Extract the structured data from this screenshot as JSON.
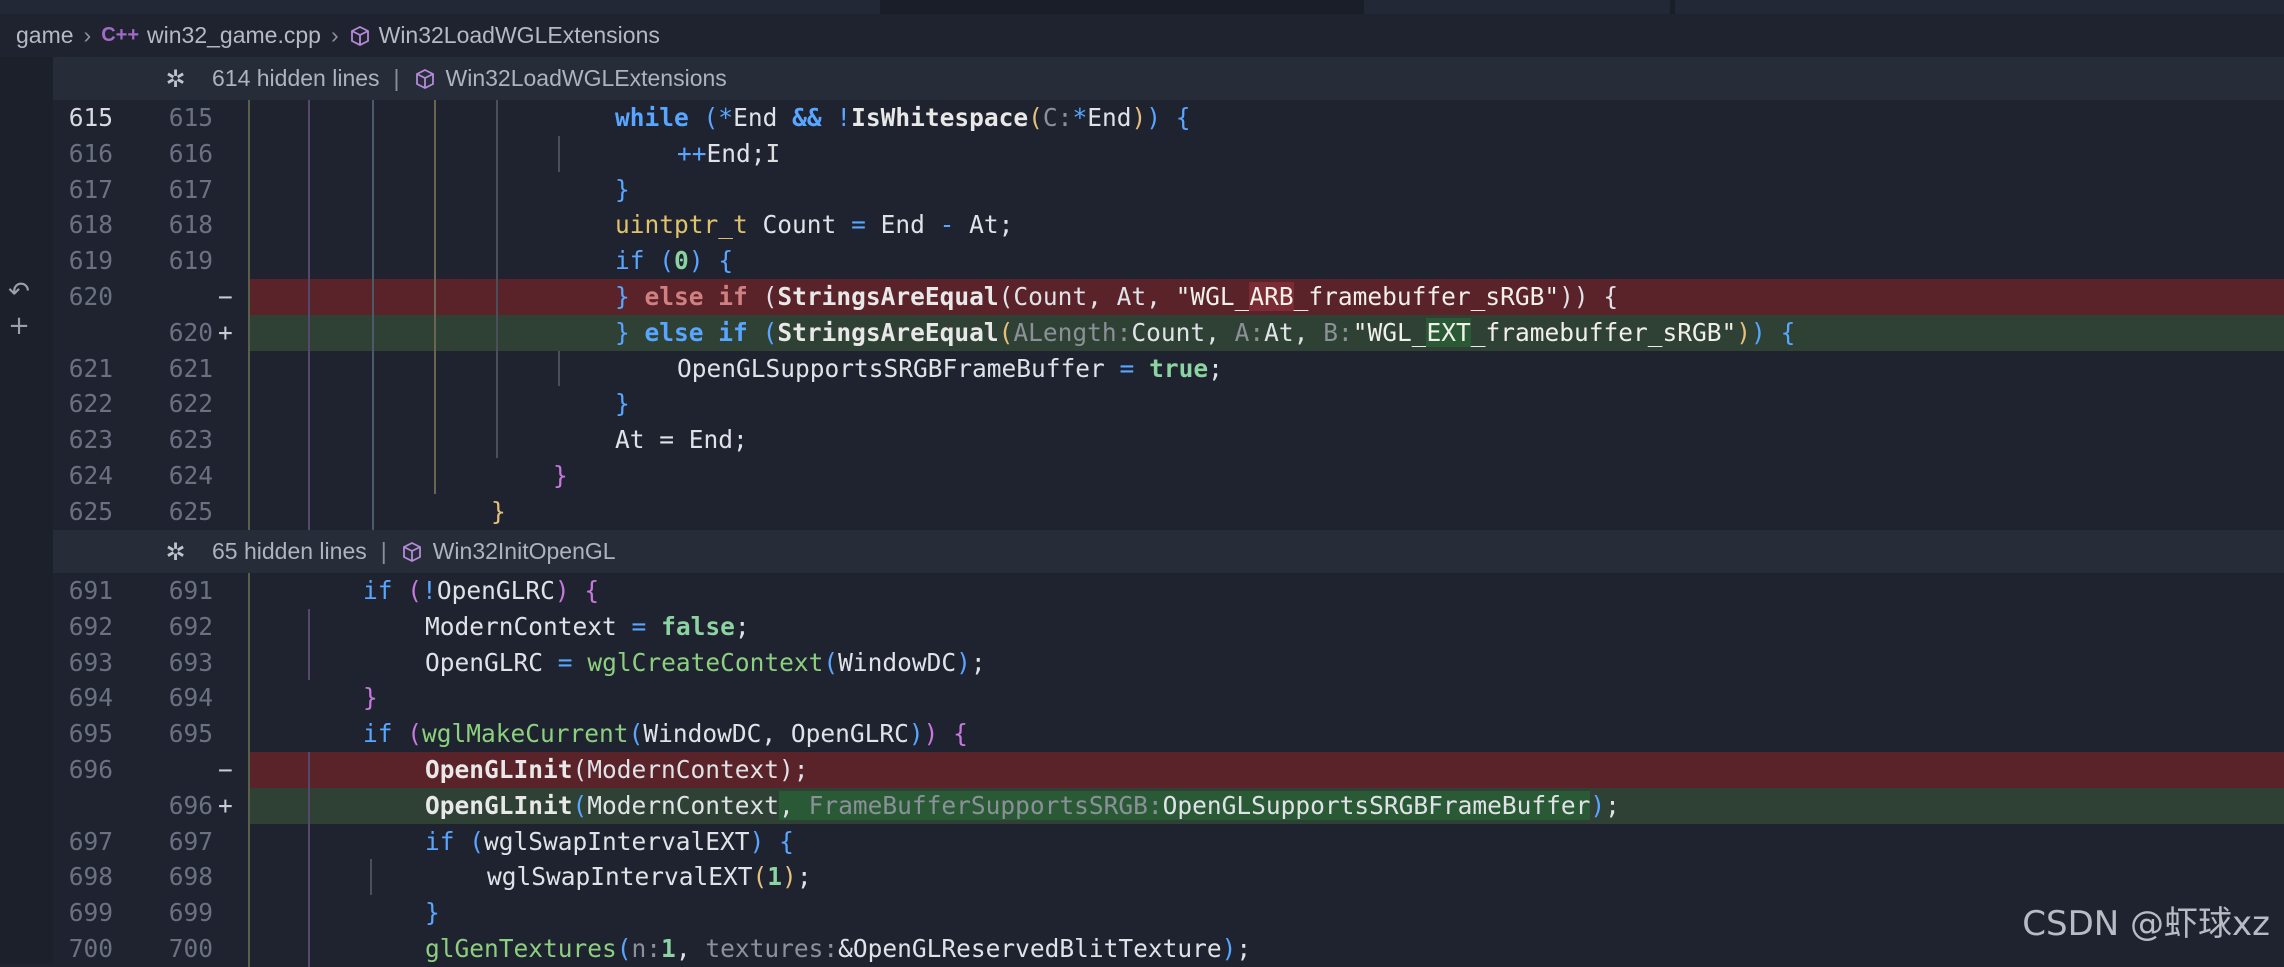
{
  "breadcrumb": {
    "items": [
      "game",
      "win32_game.cpp",
      "Win32LoadWGLExtensions"
    ],
    "cpp_badge": "C++"
  },
  "folds": [
    {
      "count": "614 hidden lines",
      "separator": "|",
      "symbol": "Win32LoadWGLExtensions"
    },
    {
      "count": "65 hidden lines",
      "separator": "|",
      "symbol": "Win32InitOpenGL"
    }
  ],
  "gutter_icons": [
    "revert-icon",
    "add-icon"
  ],
  "lines_a": [
    {
      "l": "615",
      "r": "615",
      "kind": "ctx",
      "current": true
    },
    {
      "l": "616",
      "r": "616",
      "kind": "ctx"
    },
    {
      "l": "617",
      "r": "617",
      "kind": "ctx"
    },
    {
      "l": "618",
      "r": "618",
      "kind": "ctx"
    },
    {
      "l": "619",
      "r": "619",
      "kind": "ctx"
    },
    {
      "l": "620",
      "r": "",
      "kind": "del",
      "mark": "−"
    },
    {
      "l": "",
      "r": "620",
      "kind": "add",
      "mark": "+"
    },
    {
      "l": "621",
      "r": "621",
      "kind": "ctx"
    },
    {
      "l": "622",
      "r": "622",
      "kind": "ctx"
    },
    {
      "l": "623",
      "r": "623",
      "kind": "ctx"
    },
    {
      "l": "624",
      "r": "624",
      "kind": "ctx"
    },
    {
      "l": "625",
      "r": "625",
      "kind": "ctx"
    }
  ],
  "lines_b": [
    {
      "l": "691",
      "r": "691",
      "kind": "ctx"
    },
    {
      "l": "692",
      "r": "692",
      "kind": "ctx"
    },
    {
      "l": "693",
      "r": "693",
      "kind": "ctx"
    },
    {
      "l": "694",
      "r": "694",
      "kind": "ctx"
    },
    {
      "l": "695",
      "r": "695",
      "kind": "ctx"
    },
    {
      "l": "696",
      "r": "",
      "kind": "del",
      "mark": "−"
    },
    {
      "l": "",
      "r": "696",
      "kind": "add",
      "mark": "+"
    },
    {
      "l": "697",
      "r": "697",
      "kind": "ctx"
    },
    {
      "l": "698",
      "r": "698",
      "kind": "ctx"
    },
    {
      "l": "699",
      "r": "699",
      "kind": "ctx"
    },
    {
      "l": "700",
      "r": "700",
      "kind": "ctx"
    }
  ],
  "code": {
    "while_kw": "while",
    "end_a": "*End",
    "and_op": "&&",
    "not_op": "!",
    "is_ws": "IsWhitespace",
    "hint_c": "C:",
    "end_b": "*End",
    "inc": "++End;",
    "uintptr": "uintptr_t",
    "count_decl": "Count = End - At;",
    "if_kw": "if",
    "zero": "0",
    "else_if": "else if",
    "sae": "StringsAreEqual",
    "del_args": "Count, At, ",
    "str_arb_1": "\"WGL_",
    "str_arb_2": "ARB",
    "str_arb_3": "_framebuffer_sRGB\"",
    "hint_alen": "ALength:",
    "count": "Count,",
    "hint_a": "A:",
    "at": "At,",
    "hint_b": "B:",
    "str_ext_1": "\"WGL_",
    "str_ext_2": "EXT",
    "str_ext_3": "_framebuffer_sRGB\"",
    "ogl_support": "OpenGLSupportsSRGBFrameBuffer",
    "assign": "=",
    "true_kw": "true",
    "at_end": "At = End;",
    "if_notrc": "OpenGLRC",
    "modern": "ModernContext",
    "false_kw": "false",
    "openglrc": "OpenGLRC",
    "wglcc": "wglCreateContext",
    "windowdc": "WindowDC",
    "wglmc": "wglMakeCurrent",
    "wdc_rc": "WindowDC, OpenGLRC",
    "oglinit": "OpenGLInit",
    "hint_fbs": "FrameBufferSupportsSRGB:",
    "wglswap": "wglSwapIntervalEXT",
    "one": "1",
    "glgen": "glGenTextures",
    "hint_n": "n:",
    "hint_tex": "textures:",
    "blit": "&OpenGLReservedBlitTexture"
  },
  "watermark": "CSDN @虾球xz"
}
